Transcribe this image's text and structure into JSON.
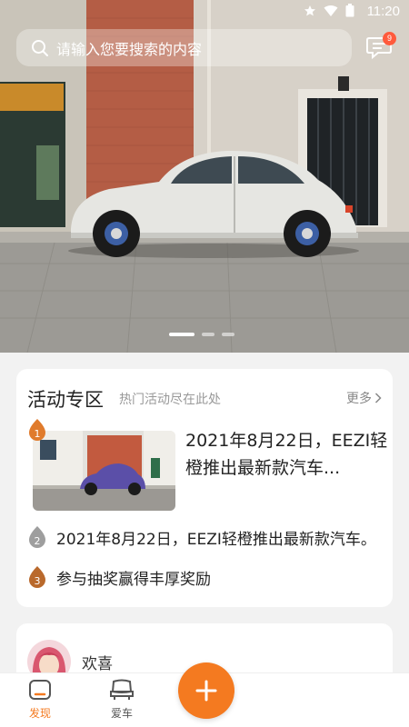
{
  "status_bar": {
    "time": "11:20"
  },
  "search": {
    "placeholder": "请输入您要搜索的内容"
  },
  "messages": {
    "badge_count": "9"
  },
  "banner": {
    "slide_count": 3,
    "active_slide": 1
  },
  "activity": {
    "title": "活动专区",
    "subtitle": "热门活动尽在此处",
    "more_label": "更多",
    "featured": {
      "rank": "1",
      "title": "2021年8月22日，EEZI轻橙推出最新款汽车..."
    },
    "items": [
      {
        "rank": "2",
        "text": "2021年8月22日，EEZI轻橙推出最新款汽车。"
      },
      {
        "rank": "3",
        "text": "参与抽奖赢得丰厚奖励"
      }
    ]
  },
  "user_card": {
    "name": "欢喜"
  },
  "bottom_nav": {
    "items": [
      {
        "label": "发现",
        "icon": "discover-icon",
        "active": true
      },
      {
        "label": "爱车",
        "icon": "car-seat-icon",
        "active": false
      }
    ],
    "fab_icon": "plus-icon"
  },
  "colors": {
    "accent": "#f47a20",
    "badge": "#ff5a3c",
    "rank_bronze": "#d9772e",
    "rank_silver": "#9a9a9a"
  }
}
